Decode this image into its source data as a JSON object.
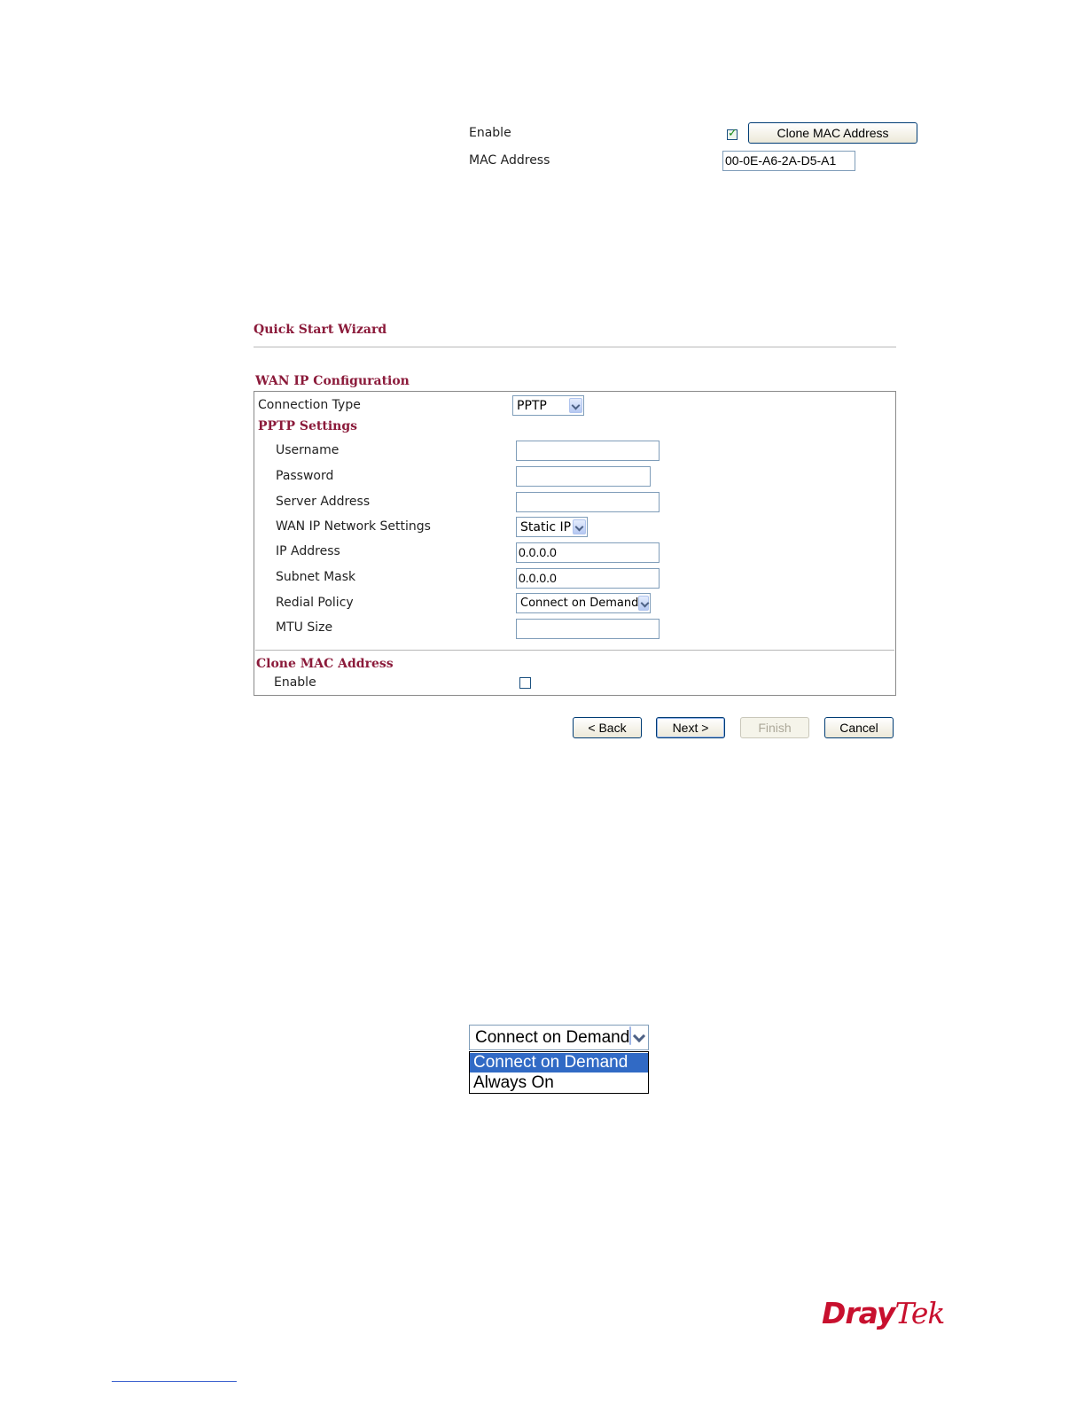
{
  "top": {
    "enable_label": "Enable",
    "enable_checked": true,
    "clone_button": "Clone MAC Address",
    "mac_label": "MAC Address",
    "mac_value": "00-0E-A6-2A-D5-A1"
  },
  "wizard": {
    "title": "Quick Start Wizard",
    "section_title": "WAN IP Configuration",
    "connection_type_label": "Connection Type",
    "connection_type_value": "PPTP",
    "pptp_title": "PPTP Settings",
    "username_label": "Username",
    "username_value": "",
    "password_label": "Password",
    "password_value": "",
    "server_label": "Server Address",
    "server_value": "",
    "wan_net_label": "WAN IP Network Settings",
    "wan_net_value": "Static IP",
    "ip_label": "IP Address",
    "ip_value": "0.0.0.0",
    "mask_label": "Subnet Mask",
    "mask_value": "0.0.0.0",
    "redial_label": "Redial Policy",
    "redial_value": "Connect on Demand",
    "mtu_label": "MTU Size",
    "mtu_value": "",
    "clone_title": "Clone MAC Address",
    "clone_enable_label": "Enable",
    "clone_enable_checked": false,
    "buttons": {
      "back": "< Back",
      "next": "Next >",
      "finish": "Finish",
      "cancel": "Cancel"
    }
  },
  "dropdown": {
    "selected": "Connect on Demand",
    "options": [
      "Connect on Demand",
      "Always On"
    ],
    "highlight_color": "#316ac5"
  },
  "brand": {
    "logo_part1": "Dray",
    "logo_part2": "Tek",
    "color": "#c8102e"
  }
}
